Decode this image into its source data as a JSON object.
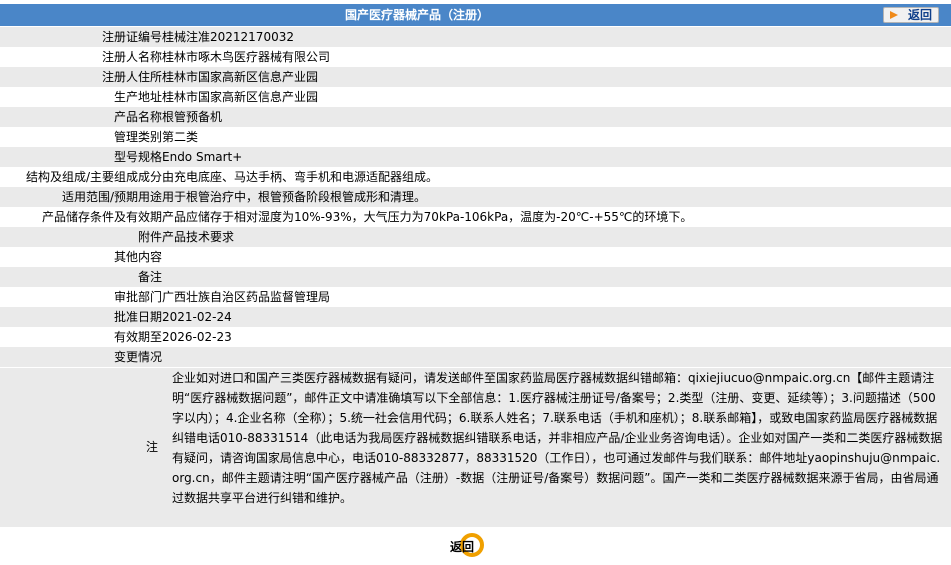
{
  "header": {
    "title": "国产医疗器械产品（注册）",
    "back_label": "返回"
  },
  "rows": [
    {
      "label": "注册证编号",
      "value": "桂械注准20212170032"
    },
    {
      "label": "注册人名称",
      "value": "桂林市啄木鸟医疗器械有限公司"
    },
    {
      "label": "注册人住所",
      "value": "桂林市国家高新区信息产业园"
    },
    {
      "label": "生产地址",
      "value": "桂林市国家高新区信息产业园"
    },
    {
      "label": "产品名称",
      "value": "根管预备机"
    },
    {
      "label": "管理类别",
      "value": "第二类"
    },
    {
      "label": "型号规格",
      "value": "Endo Smart+"
    },
    {
      "label": "结构及组成/主要组成成分",
      "value": "由充电底座、马达手柄、弯手机和电源适配器组成。"
    },
    {
      "label": "适用范围/预期用途",
      "value": "用于根管治疗中，根管预备阶段根管成形和清理。"
    },
    {
      "label": "产品储存条件及有效期",
      "value": "产品应储存于相对湿度为10%-93%，大气压力为70kPa-106kPa，温度为-20℃-+55℃的环境下。"
    },
    {
      "label": "附件",
      "value": "产品技术要求"
    },
    {
      "label": "其他内容",
      "value": ""
    },
    {
      "label": "备注",
      "value": ""
    },
    {
      "label": "审批部门",
      "value": "广西壮族自治区药品监督管理局"
    },
    {
      "label": "批准日期",
      "value": "2021-02-24"
    },
    {
      "label": "有效期至",
      "value": "2026-02-23"
    },
    {
      "label": "变更情况",
      "value": ""
    }
  ],
  "note": {
    "label": "注",
    "text": "企业如对进口和国产三类医疗器械数据有疑问，请发送邮件至国家药监局医疗器械数据纠错邮箱：qixiejiucuo@nmpaic.org.cn【邮件主题请注明“医疗器械数据问题”，邮件正文中请准确填写以下全部信息：1.医疗器械注册证号/备案号；2.类型（注册、变更、延续等）；3.问题描述（500字以内）；4.企业名称（全称）；5.统一社会信用代码；6.联系人姓名；7.联系电话（手机和座机）；8.联系邮箱】，或致电国家药监局医疗器械数据纠错电话010-88331514（此电话为我局医疗器械数据纠错联系电话，并非相应产品/企业业务咨询电话）。企业如对国产一类和二类医疗器械数据有疑问，请咨询国家局信息中心，电话010-88332877，88331520（工作日），也可通过发邮件与我们联系：邮件地址yaopinshuju@nmpaic.org.cn，邮件主题请注明“国产医疗器械产品（注册）-数据（注册证号/备案号）数据问题”。国产一类和二类医疗器械数据来源于省局，由省局通过数据共享平台进行纠错和维护。"
  },
  "footer": {
    "back_label": "返回"
  },
  "colors": {
    "title_bar": "#4a86c8",
    "row_alt": "#eaeaea",
    "back_arrow": "#f08a1a",
    "back_ring": "#f0a000"
  },
  "icons": {
    "back_top": "orange-arrow-icon",
    "back_bottom": "orange-ring-icon"
  }
}
